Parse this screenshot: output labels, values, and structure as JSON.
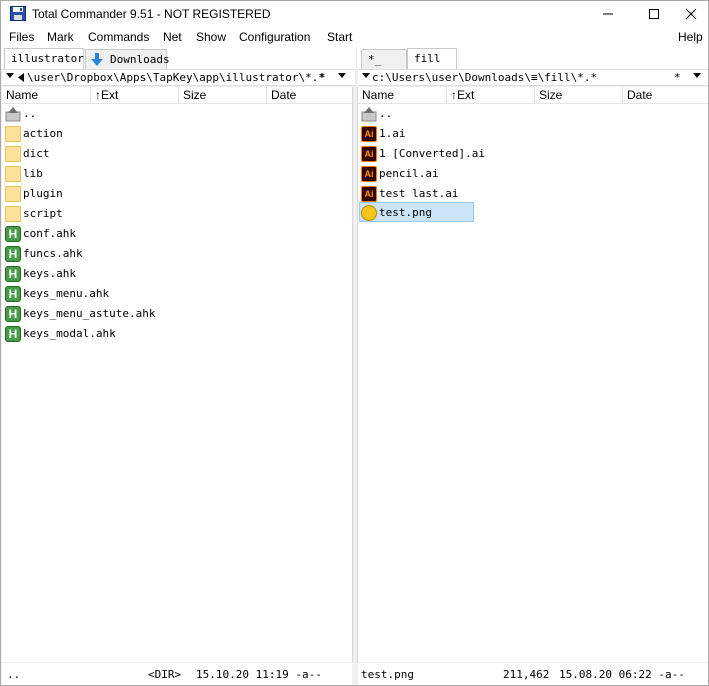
{
  "window": {
    "title": "Total Commander 9.51 - NOT REGISTERED"
  },
  "menu": [
    "Files",
    "Mark",
    "Commands",
    "Net",
    "Show",
    "Configuration",
    "Start",
    "Help"
  ],
  "left": {
    "tabs": [
      "illustrator",
      "Downloads"
    ],
    "path": "\\user\\Dropbox\\Apps\\TapKey\\app\\illustrator\\*.*",
    "star": "*",
    "columns": [
      "Name",
      "↑Ext",
      "Size",
      "Date"
    ],
    "files": [
      {
        "name": "..",
        "icon": "up-folder-icon"
      },
      {
        "name": "action",
        "icon": "folder-icon"
      },
      {
        "name": "dict",
        "icon": "folder-icon"
      },
      {
        "name": "lib",
        "icon": "folder-icon"
      },
      {
        "name": "plugin",
        "icon": "folder-icon"
      },
      {
        "name": "script",
        "icon": "folder-icon"
      },
      {
        "name": "conf.ahk",
        "icon": "ahk-file-icon"
      },
      {
        "name": "funcs.ahk",
        "icon": "ahk-file-icon"
      },
      {
        "name": "keys.ahk",
        "icon": "ahk-file-icon"
      },
      {
        "name": "keys_menu.ahk",
        "icon": "ahk-file-icon"
      },
      {
        "name": "keys_menu_astute.ahk",
        "icon": "ahk-file-icon"
      },
      {
        "name": "keys_modal.ahk",
        "icon": "ahk-file-icon"
      }
    ],
    "status": {
      "name": "..",
      "size": "<DIR>",
      "date": "15.10.20 11:19 -a--"
    }
  },
  "right": {
    "tabs": [
      "*_",
      "fill"
    ],
    "path": "c:\\Users\\user\\Downloads\\≡\\fill\\*.*",
    "star": "*",
    "columns": [
      "Name",
      "↑Ext",
      "Size",
      "Date"
    ],
    "files": [
      {
        "name": "..",
        "icon": "up-folder-icon"
      },
      {
        "name": "1.ai",
        "icon": "ai-file-icon"
      },
      {
        "name": "1 [Converted].ai",
        "icon": "ai-file-icon"
      },
      {
        "name": "pencil.ai",
        "icon": "ai-file-icon"
      },
      {
        "name": "test last.ai",
        "icon": "ai-file-icon"
      },
      {
        "name": "test.png",
        "icon": "png-file-icon",
        "selected": true
      }
    ],
    "status": {
      "name": "test.png",
      "size": "211,462",
      "date": "15.08.20 06:22 -a--"
    }
  },
  "icon_labels": {
    "ahk": "H",
    "ai": "Ai"
  },
  "colors": {
    "selection": "#cce4f7",
    "folder": "#fbe29a",
    "ahk": "#4a9a4a",
    "ai_bg": "#330000",
    "ai_fg": "#ff9a00"
  }
}
